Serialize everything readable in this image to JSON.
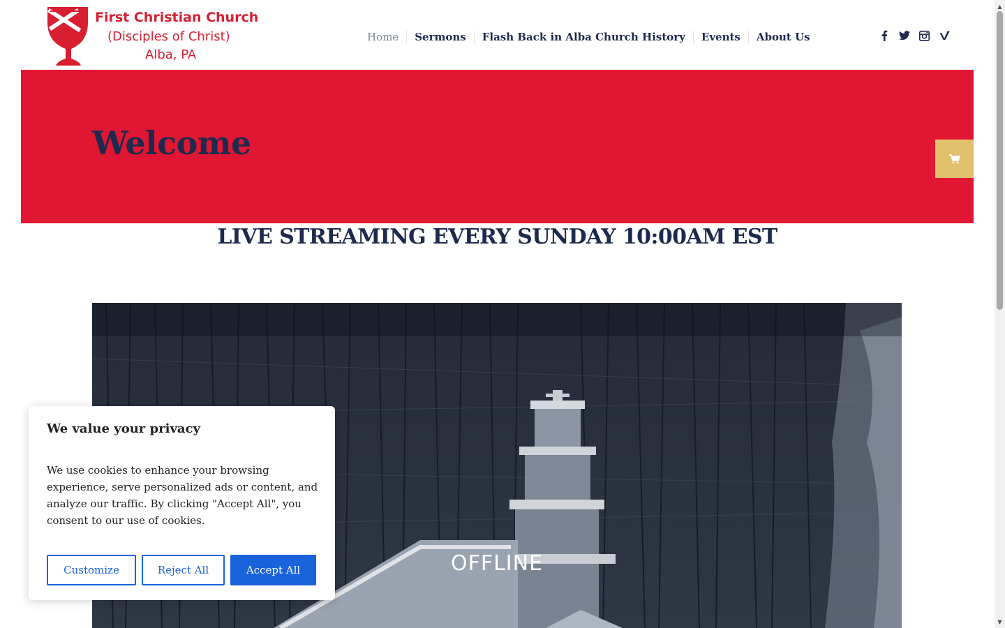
{
  "logo": {
    "line1": "First Christian Church",
    "line2": "(Disciples of Christ)",
    "line3": "Alba, PA",
    "icon": "chalice-cross-icon",
    "color": "#d71f31"
  },
  "nav": {
    "items": [
      "Home",
      "Sermons",
      "Flash Back in Alba Church History",
      "Events",
      "About Us"
    ],
    "active": "Home"
  },
  "social": [
    "facebook-icon",
    "twitter-icon",
    "instagram-icon",
    "vimeo-icon"
  ],
  "hero": {
    "title": "Welcome",
    "background": "#e01632",
    "cart_icon": "cart-icon",
    "cart_color": "#e1c06e"
  },
  "live_banner": "LIVE STREAMING EVERY SUNDAY 10:00AM EST",
  "video": {
    "status": "OFFLINE"
  },
  "cookie": {
    "title": "We value your privacy",
    "body": "We use cookies to enhance your browsing experience, serve personalized ads or content, and analyze our traffic. By clicking \"Accept All\", you consent to our use of cookies.",
    "customize_label": "Customize",
    "reject_label": "Reject All",
    "accept_label": "Accept All",
    "accent": "#1863dc"
  }
}
